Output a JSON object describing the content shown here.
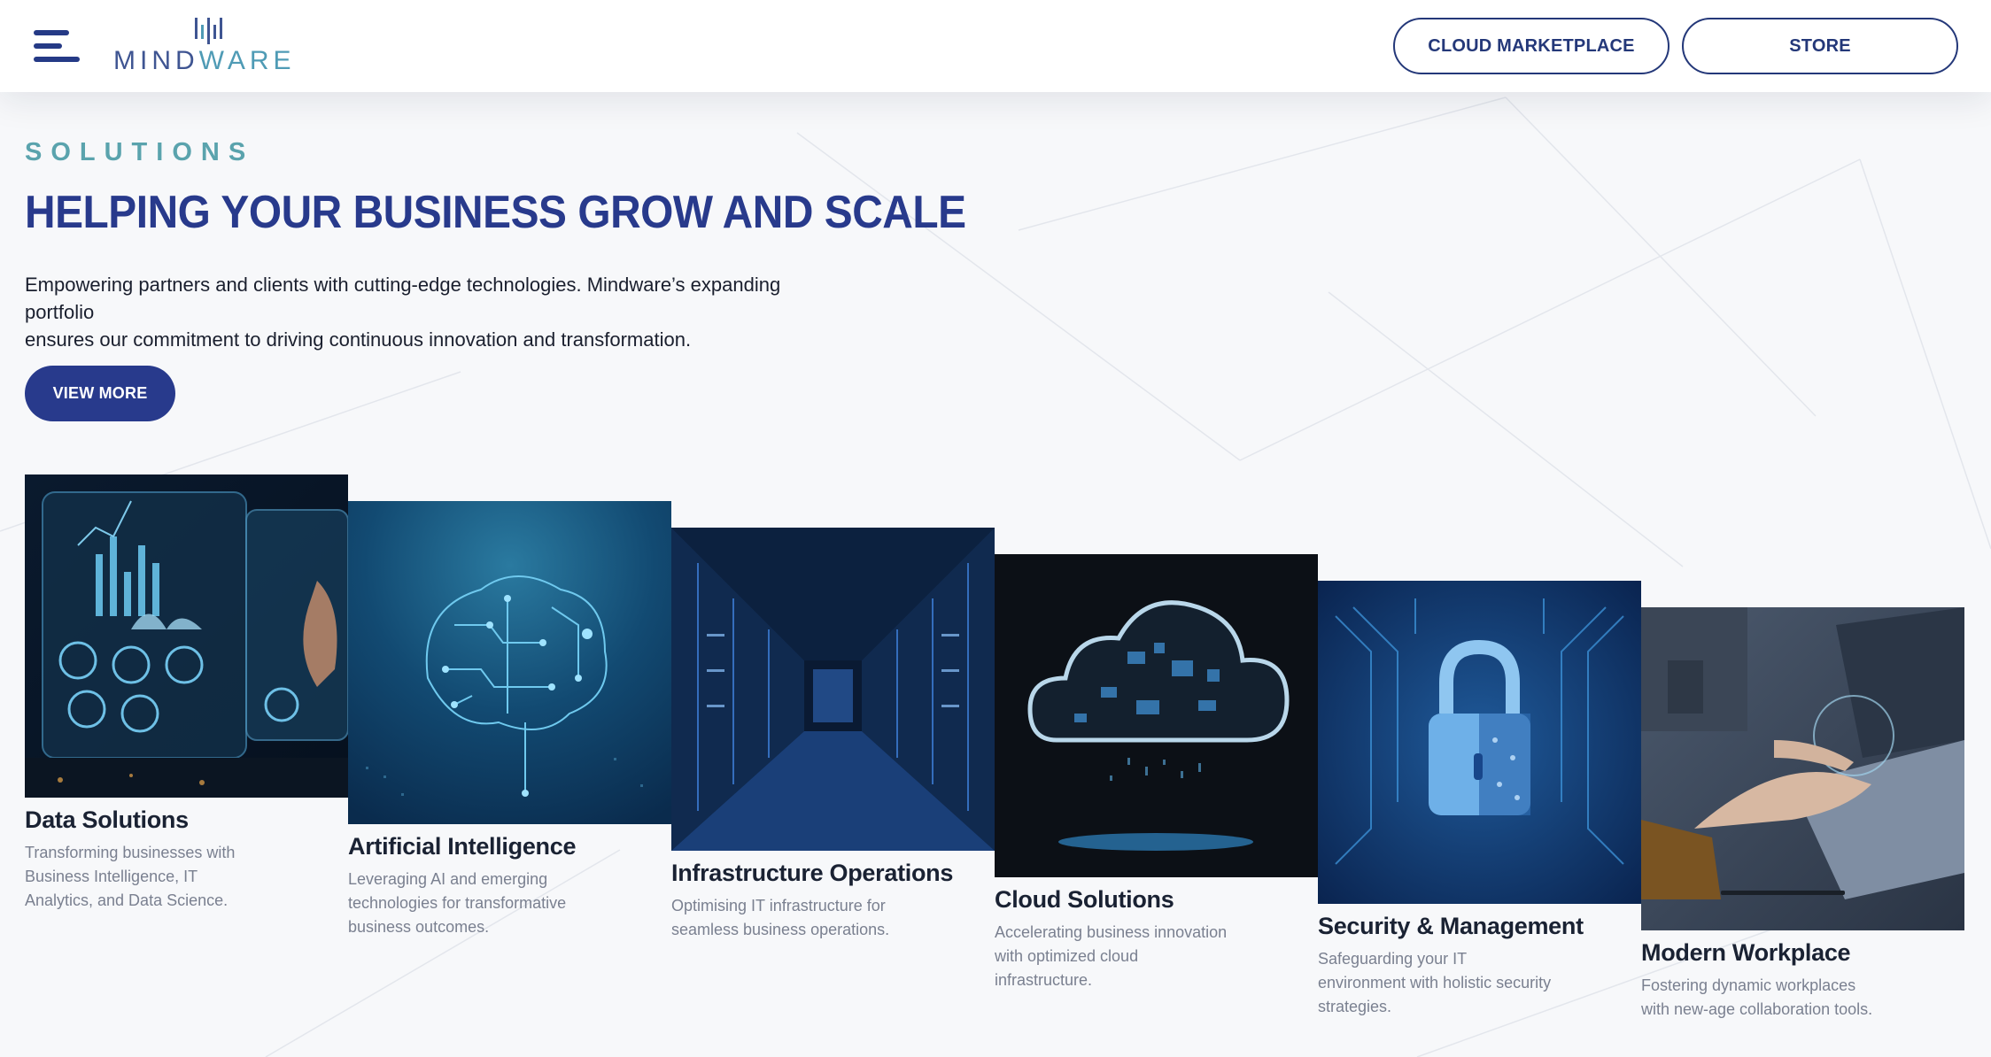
{
  "header": {
    "logo_text": "MINDWARE",
    "logo_text_main": "MIND",
    "logo_text_accent": "WARE",
    "buttons": {
      "cloud_marketplace": "CLOUD MARKETPLACE",
      "store": "STORE"
    }
  },
  "hero": {
    "eyebrow": "SOLUTIONS",
    "headline": "HELPING YOUR BUSINESS GROW AND SCALE",
    "intro_line1": "Empowering partners and clients with cutting-edge technologies. Mindware’s expanding portfolio",
    "intro_line2": "ensures our commitment to driving continuous innovation and transformation.",
    "cta": "VIEW MORE"
  },
  "cards": [
    {
      "title": "Data Solutions",
      "description": "Transforming businesses with Business Intelligence, IT Analytics, and Data Science.",
      "icon": "data-dashboard-image"
    },
    {
      "title": "Artificial Intelligence",
      "description": "Leveraging AI and emerging technologies for transformative business outcomes.",
      "icon": "circuit-brain-image"
    },
    {
      "title": "Infrastructure Operations",
      "description": "Optimising IT infrastructure for seamless business operations.",
      "icon": "server-room-image"
    },
    {
      "title": "Cloud Solutions",
      "description": "Accelerating business innovation with optimized cloud infrastructure.",
      "icon": "digital-cloud-image"
    },
    {
      "title": "Security & Management",
      "description": "Safeguarding your IT environment with holistic security strategies.",
      "icon": "padlock-circuit-image"
    },
    {
      "title": "Modern Workplace",
      "description": "Fostering dynamic workplaces with new-age collaboration tools.",
      "icon": "laptop-workplace-image"
    }
  ],
  "colors": {
    "brand_navy": "#283a8c",
    "accent_teal": "#5aa3ad",
    "text_dark": "#1a2233",
    "text_muted": "#7a8090"
  }
}
